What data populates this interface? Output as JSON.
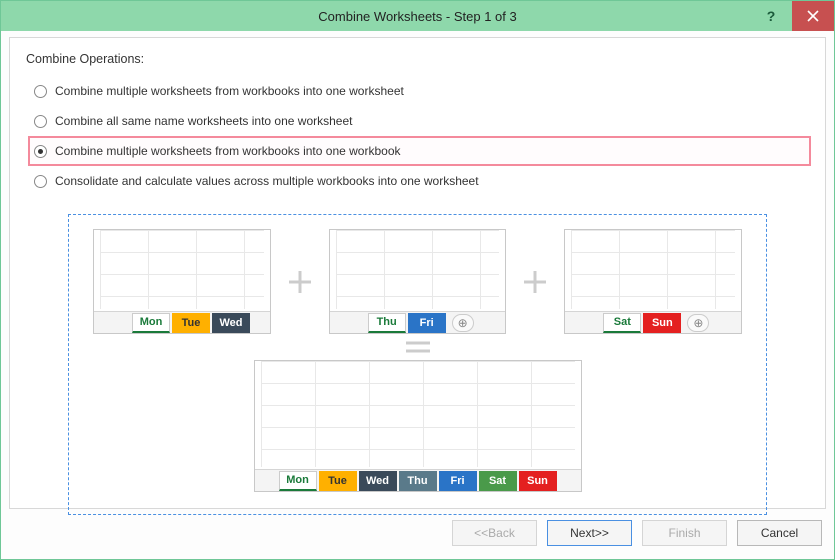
{
  "window": {
    "title": "Combine Worksheets - Step 1 of 3"
  },
  "section_title": "Combine Operations:",
  "options": [
    {
      "label": "Combine multiple worksheets from workbooks into one worksheet",
      "selected": false,
      "highlight": false
    },
    {
      "label": "Combine all same name worksheets into one worksheet",
      "selected": false,
      "highlight": false
    },
    {
      "label": "Combine multiple worksheets from workbooks into one workbook",
      "selected": true,
      "highlight": true
    },
    {
      "label": "Consolidate and calculate values across multiple workbooks into one worksheet",
      "selected": false,
      "highlight": false
    }
  ],
  "preview": {
    "wb1": {
      "tabs": [
        "Mon",
        "Tue",
        "Wed"
      ],
      "active": 0,
      "styles": [
        "active",
        "orange",
        "dark"
      ]
    },
    "wb2": {
      "tabs": [
        "Thu",
        "Fri"
      ],
      "active": 0,
      "styles": [
        "active",
        "blue"
      ],
      "show_add": true
    },
    "wb3": {
      "tabs": [
        "Sat",
        "Sun"
      ],
      "active": 0,
      "styles": [
        "active",
        "red"
      ],
      "show_add": true
    },
    "result": {
      "tabs": [
        "Mon",
        "Tue",
        "Wed",
        "Thu",
        "Fri",
        "Sat",
        "Sun"
      ],
      "active": 0,
      "styles": [
        "active",
        "orange",
        "dark",
        "slate",
        "blue",
        "green",
        "red"
      ]
    }
  },
  "footer": {
    "back": "<<Back",
    "next": "Next>>",
    "finish": "Finish",
    "cancel": "Cancel"
  }
}
